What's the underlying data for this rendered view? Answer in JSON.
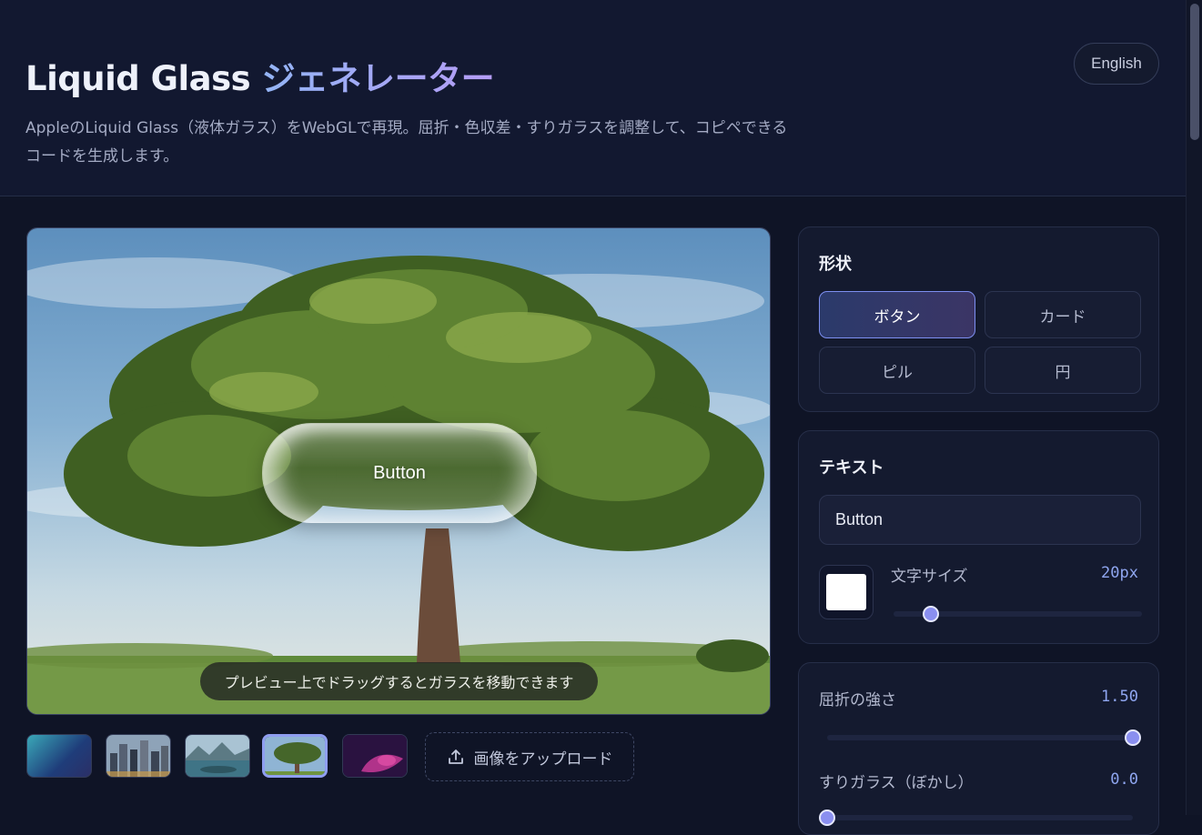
{
  "header": {
    "title_main": "Liquid Glass",
    "title_accent": "ジェネレーター",
    "subtitle": "AppleのLiquid Glass（液体ガラス）をWebGLで再現。屈折・色収差・すりガラスを調整して、コピペできるコードを生成します。",
    "language_button": "English"
  },
  "preview": {
    "glass_label": "Button",
    "drag_hint": "プレビュー上でドラッグするとガラスを移動できます"
  },
  "backgrounds": {
    "thumbnails": [
      "gradient",
      "city",
      "lake",
      "tree",
      "abstract"
    ],
    "selected": "tree",
    "upload_label": "画像をアップロード"
  },
  "shape_panel": {
    "title": "形状",
    "options": [
      "ボタン",
      "カード",
      "ピル",
      "円"
    ],
    "selected": "ボタン"
  },
  "text_panel": {
    "title": "テキスト",
    "text_value": "Button",
    "text_color": "#ffffff",
    "font_size_label": "文字サイズ",
    "font_size_value": "20px",
    "font_size_fraction": 0.15
  },
  "effects_panel": {
    "refraction_label": "屈折の強さ",
    "refraction_value": "1.50",
    "refraction_fraction": 1.0,
    "blur_label": "すりガラス（ぼかし）",
    "blur_value": "0.0",
    "blur_fraction": 0.0
  },
  "colors": {
    "accent": "#8a8ff0",
    "value_text": "#8fa6f0",
    "background": "#0f1426"
  }
}
